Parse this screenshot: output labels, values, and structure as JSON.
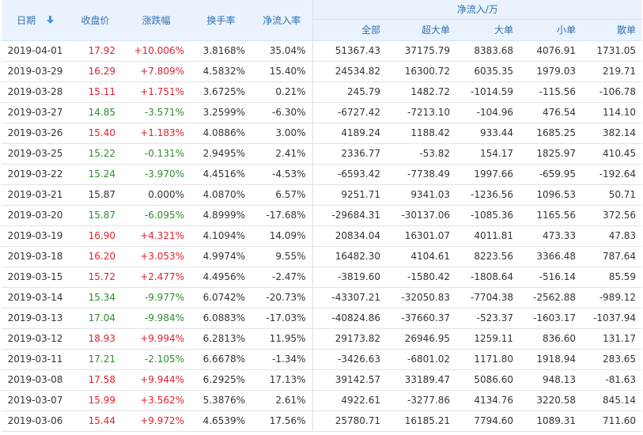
{
  "headers": {
    "date": "日期",
    "close": "收盘价",
    "change": "涨跌幅",
    "turnover": "换手率",
    "net_ratio": "净流入率",
    "net_group": "净流入/万",
    "all": "全部",
    "super": "超大单",
    "large": "大单",
    "small": "小单",
    "retail": "散单"
  },
  "colors": {
    "up": "#e0202c",
    "down": "#2e8b2e",
    "header_text": "#2f6fb3",
    "header_bg": "#eaf3fd"
  },
  "rows": [
    {
      "date": "2019-04-01",
      "close": "17.92",
      "change": "+10.006%",
      "turnover": "3.8168%",
      "net_ratio": "35.04%",
      "all": "51367.43",
      "super": "37175.79",
      "large": "8383.68",
      "small": "4076.91",
      "retail": "1731.05",
      "trend": "up"
    },
    {
      "date": "2019-03-29",
      "close": "16.29",
      "change": "+7.809%",
      "turnover": "4.5832%",
      "net_ratio": "15.40%",
      "all": "24534.82",
      "super": "16300.72",
      "large": "6035.35",
      "small": "1979.03",
      "retail": "219.71",
      "trend": "up"
    },
    {
      "date": "2019-03-28",
      "close": "15.11",
      "change": "+1.751%",
      "turnover": "3.6725%",
      "net_ratio": "0.21%",
      "all": "245.79",
      "super": "1482.72",
      "large": "-1014.59",
      "small": "-115.56",
      "retail": "-106.78",
      "trend": "up"
    },
    {
      "date": "2019-03-27",
      "close": "14.85",
      "change": "-3.571%",
      "turnover": "3.2599%",
      "net_ratio": "-6.30%",
      "all": "-6727.42",
      "super": "-7213.10",
      "large": "-104.96",
      "small": "476.54",
      "retail": "114.10",
      "trend": "down"
    },
    {
      "date": "2019-03-26",
      "close": "15.40",
      "change": "+1.183%",
      "turnover": "4.0886%",
      "net_ratio": "3.00%",
      "all": "4189.24",
      "super": "1188.42",
      "large": "933.44",
      "small": "1685.25",
      "retail": "382.14",
      "trend": "up"
    },
    {
      "date": "2019-03-25",
      "close": "15.22",
      "change": "-0.131%",
      "turnover": "2.9495%",
      "net_ratio": "2.41%",
      "all": "2336.77",
      "super": "-53.82",
      "large": "154.17",
      "small": "1825.97",
      "retail": "410.45",
      "trend": "down"
    },
    {
      "date": "2019-03-22",
      "close": "15.24",
      "change": "-3.970%",
      "turnover": "4.4516%",
      "net_ratio": "-4.53%",
      "all": "-6593.42",
      "super": "-7738.49",
      "large": "1997.66",
      "small": "-659.95",
      "retail": "-192.64",
      "trend": "down"
    },
    {
      "date": "2019-03-21",
      "close": "15.87",
      "change": "0.000%",
      "turnover": "4.0870%",
      "net_ratio": "6.57%",
      "all": "9251.71",
      "super": "9341.03",
      "large": "-1236.56",
      "small": "1096.53",
      "retail": "50.71",
      "trend": "flat"
    },
    {
      "date": "2019-03-20",
      "close": "15.87",
      "change": "-6.095%",
      "turnover": "4.8999%",
      "net_ratio": "-17.68%",
      "all": "-29684.31",
      "super": "-30137.06",
      "large": "-1085.36",
      "small": "1165.56",
      "retail": "372.56",
      "trend": "down"
    },
    {
      "date": "2019-03-19",
      "close": "16.90",
      "change": "+4.321%",
      "turnover": "4.1094%",
      "net_ratio": "14.09%",
      "all": "20834.04",
      "super": "16301.07",
      "large": "4011.81",
      "small": "473.33",
      "retail": "47.83",
      "trend": "up"
    },
    {
      "date": "2019-03-18",
      "close": "16.20",
      "change": "+3.053%",
      "turnover": "4.9974%",
      "net_ratio": "9.55%",
      "all": "16482.30",
      "super": "4104.61",
      "large": "8223.56",
      "small": "3366.48",
      "retail": "787.64",
      "trend": "up"
    },
    {
      "date": "2019-03-15",
      "close": "15.72",
      "change": "+2.477%",
      "turnover": "4.4956%",
      "net_ratio": "-2.47%",
      "all": "-3819.60",
      "super": "-1580.42",
      "large": "-1808.64",
      "small": "-516.14",
      "retail": "85.59",
      "trend": "up"
    },
    {
      "date": "2019-03-14",
      "close": "15.34",
      "change": "-9.977%",
      "turnover": "6.0742%",
      "net_ratio": "-20.73%",
      "all": "-43307.21",
      "super": "-32050.83",
      "large": "-7704.38",
      "small": "-2562.88",
      "retail": "-989.12",
      "trend": "down"
    },
    {
      "date": "2019-03-13",
      "close": "17.04",
      "change": "-9.984%",
      "turnover": "6.0883%",
      "net_ratio": "-17.03%",
      "all": "-40824.86",
      "super": "-37660.37",
      "large": "-523.37",
      "small": "-1603.17",
      "retail": "-1037.94",
      "trend": "down"
    },
    {
      "date": "2019-03-12",
      "close": "18.93",
      "change": "+9.994%",
      "turnover": "6.2813%",
      "net_ratio": "11.95%",
      "all": "29173.82",
      "super": "26946.95",
      "large": "1259.11",
      "small": "836.60",
      "retail": "131.17",
      "trend": "up"
    },
    {
      "date": "2019-03-11",
      "close": "17.21",
      "change": "-2.105%",
      "turnover": "6.6678%",
      "net_ratio": "-1.34%",
      "all": "-3426.63",
      "super": "-6801.02",
      "large": "1171.80",
      "small": "1918.94",
      "retail": "283.65",
      "trend": "down"
    },
    {
      "date": "2019-03-08",
      "close": "17.58",
      "change": "+9.944%",
      "turnover": "6.2925%",
      "net_ratio": "17.13%",
      "all": "39142.57",
      "super": "33189.47",
      "large": "5086.60",
      "small": "948.13",
      "retail": "-81.63",
      "trend": "up"
    },
    {
      "date": "2019-03-07",
      "close": "15.99",
      "change": "+3.562%",
      "turnover": "5.3876%",
      "net_ratio": "2.61%",
      "all": "4922.61",
      "super": "-3277.86",
      "large": "4134.76",
      "small": "3220.58",
      "retail": "845.14",
      "trend": "up"
    },
    {
      "date": "2019-03-06",
      "close": "15.44",
      "change": "+9.972%",
      "turnover": "4.6539%",
      "net_ratio": "17.56%",
      "all": "25780.71",
      "super": "16185.21",
      "large": "7794.60",
      "small": "1089.31",
      "retail": "711.60",
      "trend": "up"
    }
  ]
}
